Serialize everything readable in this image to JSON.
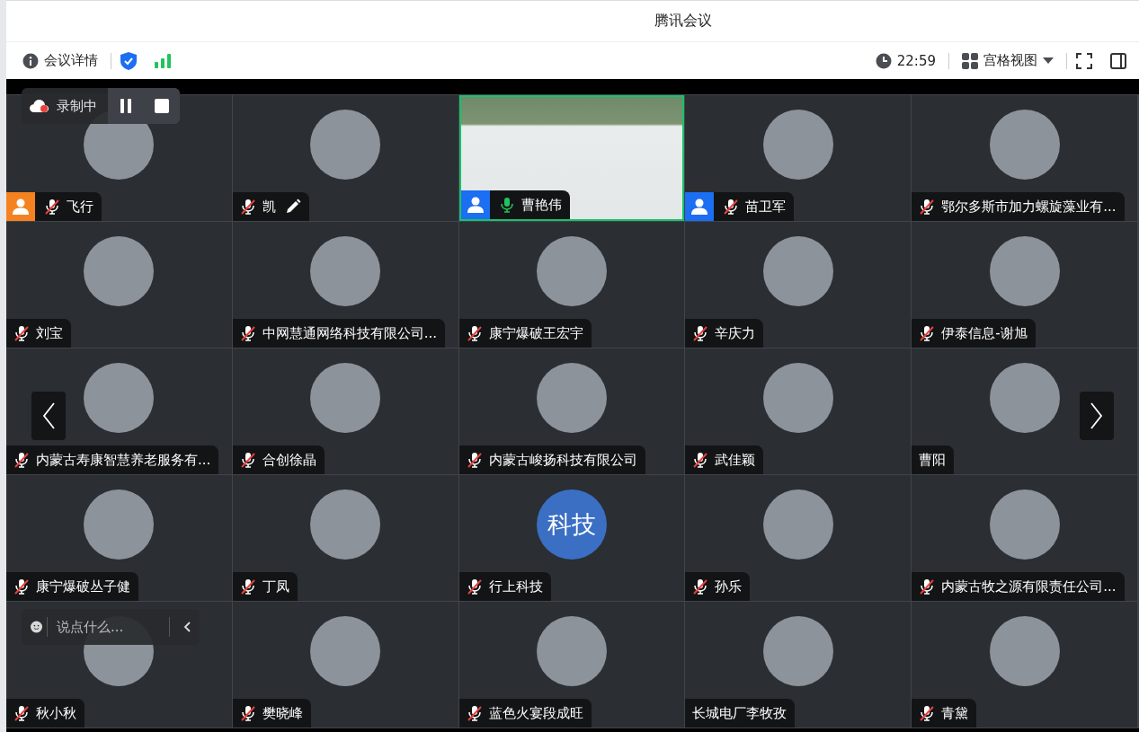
{
  "window": {
    "title": "腾讯会议"
  },
  "toolbar": {
    "details": "会议详情",
    "time": "22:59",
    "view": "宫格视图"
  },
  "recording": {
    "label": "录制中"
  },
  "chat": {
    "placeholder": "说点什么..."
  },
  "participants": [
    {
      "name": "飞行",
      "kind": "photo",
      "host": true,
      "cohost": false,
      "mic_shown": true,
      "muted": true,
      "speaking": false,
      "editing": false
    },
    {
      "name": "凯",
      "kind": "photo",
      "host": false,
      "cohost": false,
      "mic_shown": true,
      "muted": true,
      "speaking": false,
      "editing": true
    },
    {
      "name": "曹艳伟",
      "kind": "video",
      "host": false,
      "cohost": true,
      "mic_shown": true,
      "muted": false,
      "speaking": true,
      "editing": false
    },
    {
      "name": "苗卫军",
      "kind": "photo",
      "host": false,
      "cohost": true,
      "mic_shown": true,
      "muted": true,
      "speaking": false,
      "editing": false
    },
    {
      "name": "鄂尔多斯市加力螺旋藻业有...",
      "kind": "photo",
      "host": false,
      "cohost": false,
      "mic_shown": true,
      "muted": true,
      "speaking": false,
      "editing": false
    },
    {
      "name": "刘宝",
      "kind": "photo",
      "host": false,
      "cohost": false,
      "mic_shown": true,
      "muted": true,
      "speaking": false,
      "editing": false
    },
    {
      "name": "中网慧通网络科技有限公司...",
      "kind": "photo",
      "host": false,
      "cohost": false,
      "mic_shown": true,
      "muted": true,
      "speaking": false,
      "editing": false
    },
    {
      "name": "康宁爆破王宏宇",
      "kind": "photo",
      "host": false,
      "cohost": false,
      "mic_shown": true,
      "muted": true,
      "speaking": false,
      "editing": false
    },
    {
      "name": "辛庆力",
      "kind": "photo",
      "host": false,
      "cohost": false,
      "mic_shown": true,
      "muted": true,
      "speaking": false,
      "editing": false
    },
    {
      "name": "伊泰信息-谢旭",
      "kind": "photo",
      "host": false,
      "cohost": false,
      "mic_shown": true,
      "muted": true,
      "speaking": false,
      "editing": false
    },
    {
      "name": "内蒙古寿康智慧养老服务有...",
      "kind": "photo",
      "host": false,
      "cohost": false,
      "mic_shown": true,
      "muted": true,
      "speaking": false,
      "editing": false
    },
    {
      "name": "合创徐晶",
      "kind": "photo",
      "host": false,
      "cohost": false,
      "mic_shown": true,
      "muted": true,
      "speaking": false,
      "editing": false
    },
    {
      "name": "内蒙古峻扬科技有限公司",
      "kind": "photo",
      "host": false,
      "cohost": false,
      "mic_shown": true,
      "muted": true,
      "speaking": false,
      "editing": false
    },
    {
      "name": "武佳颖",
      "kind": "photo",
      "host": false,
      "cohost": false,
      "mic_shown": true,
      "muted": true,
      "speaking": false,
      "editing": false
    },
    {
      "name": "曹阳",
      "kind": "photo",
      "host": false,
      "cohost": false,
      "mic_shown": false,
      "speaking": false,
      "editing": false
    },
    {
      "name": "康宁爆破丛子健",
      "kind": "photo",
      "host": false,
      "cohost": false,
      "mic_shown": true,
      "muted": true,
      "speaking": false,
      "editing": false
    },
    {
      "name": "丁凤",
      "kind": "photo",
      "host": false,
      "cohost": false,
      "mic_shown": true,
      "muted": true,
      "speaking": false,
      "editing": false
    },
    {
      "name": "行上科技",
      "kind": "text",
      "avatar_text": "科技",
      "host": false,
      "cohost": false,
      "mic_shown": true,
      "muted": true,
      "speaking": false,
      "editing": false
    },
    {
      "name": "孙乐",
      "kind": "photo",
      "host": false,
      "cohost": false,
      "mic_shown": true,
      "muted": true,
      "speaking": false,
      "editing": false
    },
    {
      "name": "内蒙古牧之源有限责任公司...",
      "kind": "photo",
      "host": false,
      "cohost": false,
      "mic_shown": true,
      "muted": true,
      "speaking": false,
      "editing": false
    },
    {
      "name": "秋小秋",
      "kind": "photo",
      "host": false,
      "cohost": false,
      "mic_shown": true,
      "muted": true,
      "speaking": false,
      "editing": false
    },
    {
      "name": "樊晓峰",
      "kind": "photo",
      "host": false,
      "cohost": false,
      "mic_shown": true,
      "muted": true,
      "speaking": false,
      "editing": false
    },
    {
      "name": "蓝色火宴段成旺",
      "kind": "photo",
      "host": false,
      "cohost": false,
      "mic_shown": true,
      "muted": true,
      "speaking": false,
      "editing": false
    },
    {
      "name": "长城电厂李牧孜",
      "kind": "photo",
      "host": false,
      "cohost": false,
      "mic_shown": false,
      "speaking": false,
      "editing": false
    },
    {
      "name": "青黛",
      "kind": "photo",
      "host": false,
      "cohost": false,
      "mic_shown": true,
      "muted": true,
      "speaking": false,
      "editing": false
    }
  ]
}
